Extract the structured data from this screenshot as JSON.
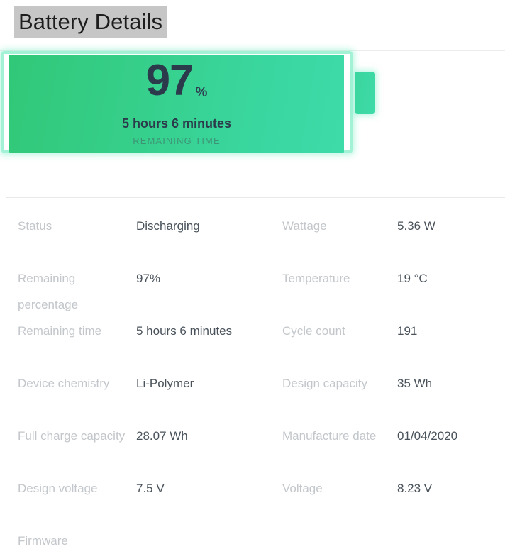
{
  "header": {
    "title": "Battery Details",
    "title_highlighted": true
  },
  "battery": {
    "percent": "97",
    "percent_symbol": "%",
    "remaining_time": "5 hours 6 minutes",
    "remaining_time_caption": "REMAINING TIME",
    "fill_level_percent": 97,
    "colors": {
      "fill_start": "#31c878",
      "fill_end": "#3edaa8",
      "glow_border": "#a4f2d6",
      "text_dark": "#2b3b4c",
      "caption": "#3f7e6c"
    }
  },
  "details": {
    "rows": [
      {
        "left_label": "Status",
        "left_value": "Discharging",
        "right_label": "Wattage",
        "right_value": "5.36 W"
      },
      {
        "left_label": "Remaining percentage",
        "left_value": "97%",
        "right_label": "Temperature",
        "right_value": "19 °C"
      },
      {
        "left_label": "Remaining time",
        "left_value": "5 hours 6 minutes",
        "right_label": "Cycle count",
        "right_value": "191"
      },
      {
        "left_label": "Device chemistry",
        "left_value": "Li-Polymer",
        "right_label": "Design capacity",
        "right_value": "35 Wh"
      },
      {
        "left_label": "Full charge capacity",
        "left_value": "28.07 Wh",
        "right_label": "Manufacture date",
        "right_value": "01/04/2020"
      },
      {
        "left_label": "Design voltage",
        "left_value": "7.5 V",
        "right_label": "Voltage",
        "right_value": "8.23 V"
      },
      {
        "left_label": "Firmware",
        "left_value": "",
        "right_label": "",
        "right_value": ""
      }
    ]
  }
}
